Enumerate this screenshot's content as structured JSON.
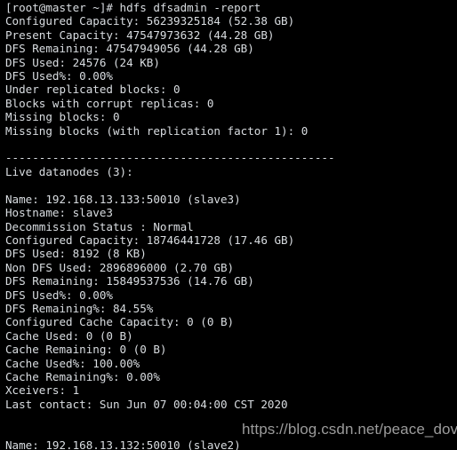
{
  "terminal": {
    "prompt_line": "[root@master ~]# hdfs dfsadmin -report",
    "lines": [
      "[root@master ~]# hdfs dfsadmin -report",
      "Configured Capacity: 56239325184 (52.38 GB)",
      "Present Capacity: 47547973632 (44.28 GB)",
      "DFS Remaining: 47547949056 (44.28 GB)",
      "DFS Used: 24576 (24 KB)",
      "DFS Used%: 0.00%",
      "Under replicated blocks: 0",
      "Blocks with corrupt replicas: 0",
      "Missing blocks: 0",
      "Missing blocks (with replication factor 1): 0",
      "",
      "-------------------------------------------------",
      "Live datanodes (3):",
      "",
      "Name: 192.168.13.133:50010 (slave3)",
      "Hostname: slave3",
      "Decommission Status : Normal",
      "Configured Capacity: 18746441728 (17.46 GB)",
      "DFS Used: 8192 (8 KB)",
      "Non DFS Used: 2896896000 (2.70 GB)",
      "DFS Remaining: 15849537536 (14.76 GB)",
      "DFS Used%: 0.00%",
      "DFS Remaining%: 84.55%",
      "Configured Cache Capacity: 0 (0 B)",
      "Cache Used: 0 (0 B)",
      "Cache Remaining: 0 (0 B)",
      "Cache Used%: 100.00%",
      "Cache Remaining%: 0.00%",
      "Xceivers: 1",
      "Last contact: Sun Jun 07 00:04:00 CST 2020",
      "",
      "",
      "Name: 192.168.13.132:50010 (slave2)"
    ],
    "cluster_summary": {
      "configured_capacity": "56239325184 (52.38 GB)",
      "present_capacity": "47547973632 (44.28 GB)",
      "dfs_remaining": "47547949056 (44.28 GB)",
      "dfs_used": "24576 (24 KB)",
      "dfs_used_percent": "0.00%",
      "under_replicated_blocks": "0",
      "blocks_with_corrupt_replicas": "0",
      "missing_blocks": "0",
      "missing_blocks_replication_factor_1": "0"
    },
    "live_datanodes_header": "Live datanodes (3):",
    "live_datanodes_count": 3,
    "datanodes": [
      {
        "name": "192.168.13.133:50010 (slave3)",
        "hostname": "slave3",
        "decommission_status": "Normal",
        "configured_capacity": "18746441728 (17.46 GB)",
        "dfs_used": "8192 (8 KB)",
        "non_dfs_used": "2896896000 (2.70 GB)",
        "dfs_remaining": "15849537536 (14.76 GB)",
        "dfs_used_percent": "0.00%",
        "dfs_remaining_percent": "84.55%",
        "configured_cache_capacity": "0 (0 B)",
        "cache_used": "0 (0 B)",
        "cache_remaining": "0 (0 B)",
        "cache_used_percent": "100.00%",
        "cache_remaining_percent": "0.00%",
        "xceivers": "1",
        "last_contact": "Sun Jun 07 00:04:00 CST 2020"
      },
      {
        "name": "192.168.13.132:50010 (slave2)"
      }
    ],
    "separator": "-------------------------------------------------"
  },
  "watermark": {
    "text": "https://blog.csdn.net/peace_dove",
    "color": "#9b9b9b"
  },
  "colors": {
    "background": "#000000",
    "text": "#d9dde1"
  }
}
